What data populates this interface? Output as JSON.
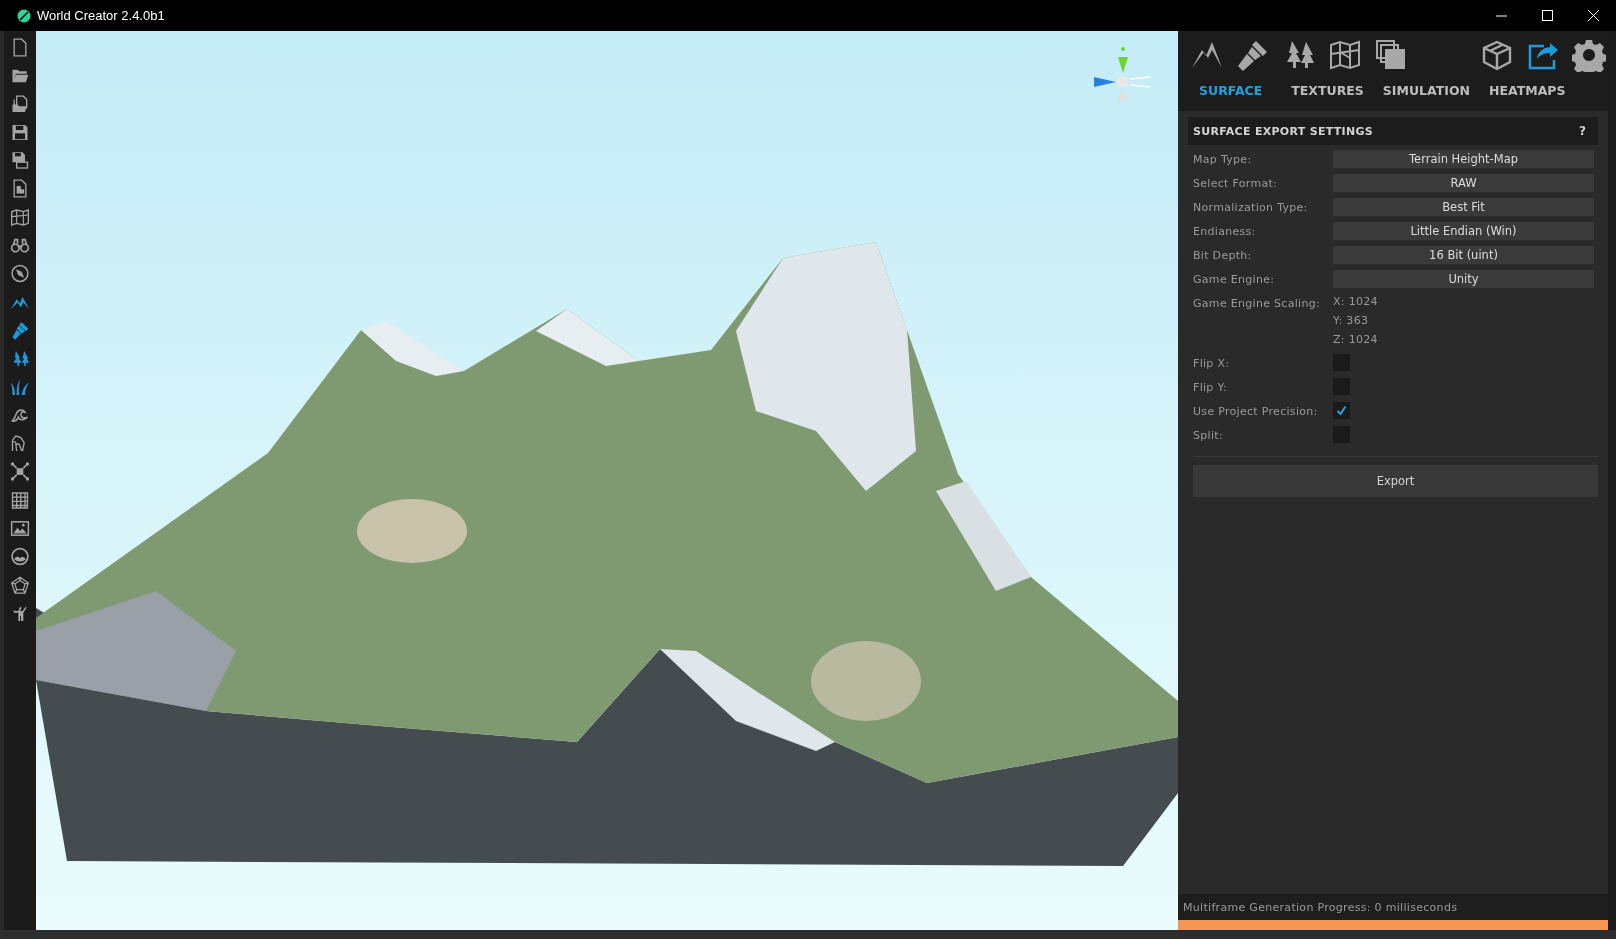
{
  "window": {
    "title": "World Creator 2.4.0b1"
  },
  "left_toolbar": [
    {
      "highlighted": false
    },
    {
      "highlighted": false
    },
    {
      "highlighted": false
    },
    {
      "highlighted": false
    },
    {
      "highlighted": false
    },
    {
      "highlighted": false
    },
    {
      "highlighted": false
    },
    {
      "highlighted": false
    },
    {
      "highlighted": false
    },
    {
      "highlighted": true
    },
    {
      "highlighted": true
    },
    {
      "highlighted": true
    },
    {
      "highlighted": true
    },
    {
      "highlighted": false
    },
    {
      "highlighted": false
    },
    {
      "highlighted": false
    },
    {
      "highlighted": false
    },
    {
      "highlighted": false
    },
    {
      "highlighted": false
    },
    {
      "highlighted": false
    },
    {
      "highlighted": false
    }
  ],
  "panel_toolbar": [
    {
      "selected": false
    },
    {
      "selected": false
    },
    {
      "selected": false
    },
    {
      "selected": false
    },
    {
      "selected": false
    },
    {
      "selected": false
    },
    {
      "selected": true
    },
    {
      "selected": false
    }
  ],
  "tabs": [
    {
      "label": "SURFACE",
      "selected": true
    },
    {
      "label": "TEXTURES",
      "selected": false
    },
    {
      "label": "SIMULATION",
      "selected": false
    },
    {
      "label": "HEATMAPS",
      "selected": false
    }
  ],
  "settings": {
    "title": "SURFACE EXPORT SETTINGS",
    "help": "?",
    "rows": [
      {
        "kind": "select",
        "label": "Map Type:",
        "value": "Terrain Height-Map"
      },
      {
        "kind": "select",
        "label": "Select Format:",
        "value": "RAW"
      },
      {
        "kind": "select",
        "label": "Normalization Type:",
        "value": "Best Fit"
      },
      {
        "kind": "select",
        "label": "Endianess:",
        "value": "Little Endian (Win)"
      },
      {
        "kind": "select",
        "label": "Bit Depth:",
        "value": "16 Bit (uint)"
      },
      {
        "kind": "select",
        "label": "Game Engine:",
        "value": "Unity"
      },
      {
        "kind": "values",
        "label": "Game Engine Scaling:",
        "values": [
          "X: 1024",
          "Y: 363",
          "Z: 1024"
        ]
      },
      {
        "kind": "checkbox",
        "label": "Flip X:",
        "checked": false
      },
      {
        "kind": "checkbox",
        "label": "Flip Y:",
        "checked": false
      },
      {
        "kind": "checkbox",
        "label": "Use Project Precision:",
        "checked": true
      },
      {
        "kind": "checkbox",
        "label": "Split:",
        "checked": false
      }
    ]
  },
  "export_button": "Export",
  "status_bar": {
    "text": "Multiframe Generation Progress: 0 milliseconds",
    "level": 1
  }
}
